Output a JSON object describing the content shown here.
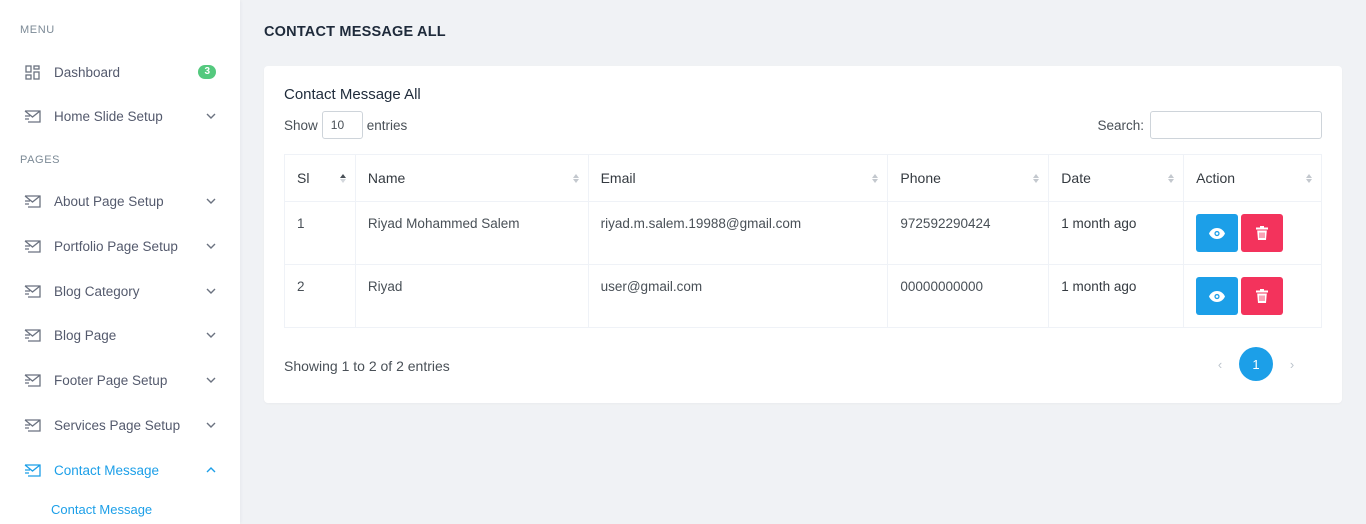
{
  "sidebar": {
    "menu_heading": "MENU",
    "pages_heading": "PAGES",
    "dashboard": {
      "label": "Dashboard",
      "badge": "3"
    },
    "items": [
      {
        "label": "Home Slide Setup"
      },
      {
        "label": "About Page Setup"
      },
      {
        "label": "Portfolio Page Setup"
      },
      {
        "label": "Blog Category"
      },
      {
        "label": "Blog Page"
      },
      {
        "label": "Footer Page Setup"
      },
      {
        "label": "Services Page Setup"
      },
      {
        "label": "Contact Message"
      }
    ],
    "submenu": {
      "label": "Contact Message"
    }
  },
  "page": {
    "title": "CONTACT MESSAGE ALL"
  },
  "card": {
    "title": "Contact Message All",
    "show_label": "Show",
    "entries_label": "entries",
    "length_value": "10",
    "search_label": "Search:",
    "search_value": ""
  },
  "table": {
    "headers": [
      "Sl",
      "Name",
      "Email",
      "Phone",
      "Date",
      "Action"
    ],
    "rows": [
      {
        "sl": "1",
        "name": "Riyad Mohammed Salem",
        "email": "riyad.m.salem.19988@gmail.com",
        "phone": "972592290424",
        "date": "1 month ago"
      },
      {
        "sl": "2",
        "name": "Riyad",
        "email": "user@gmail.com",
        "phone": "00000000000",
        "date": "1 month ago"
      }
    ]
  },
  "pagination": {
    "info": "Showing 1 to 2 of 2 entries",
    "prev": "‹",
    "next": "›",
    "current": "1"
  },
  "colors": {
    "accent": "#1c9fe8",
    "danger": "#f3335c",
    "badge": "#54c97e",
    "background": "#f0f2f5"
  },
  "icons": {
    "dashboard": "dashboard-icon",
    "menu_items": "envelope-icon",
    "chevron": "chevron-down-icon",
    "view": "eye-icon",
    "delete": "trash-icon"
  }
}
